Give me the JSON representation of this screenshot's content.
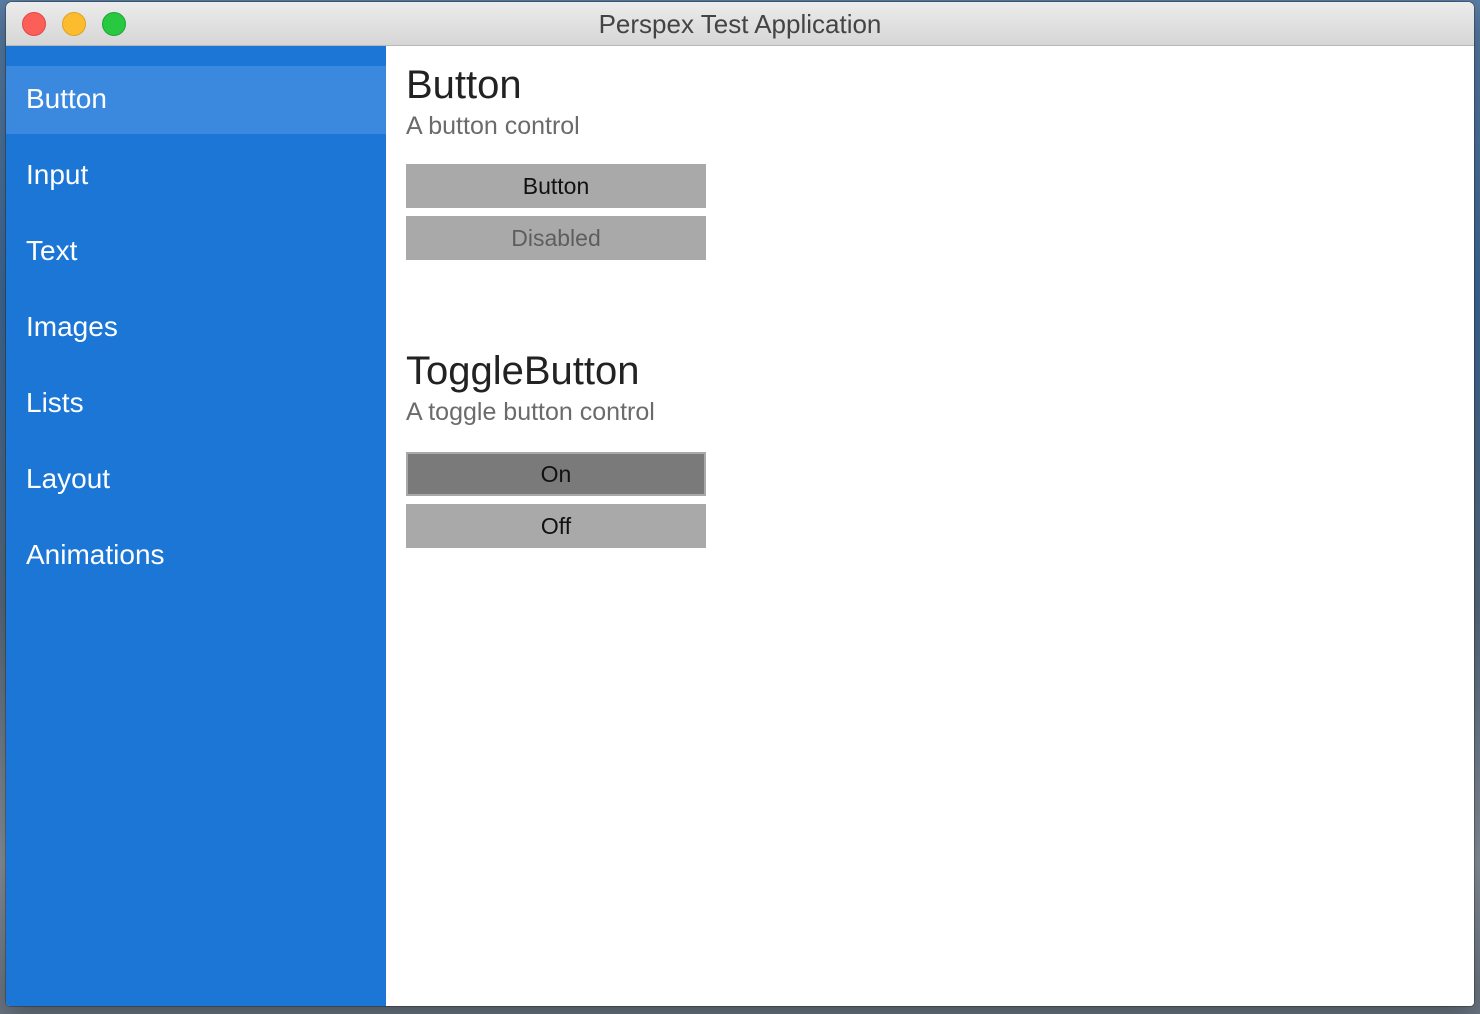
{
  "window": {
    "title": "Perspex Test Application"
  },
  "sidebar": {
    "items": [
      {
        "label": "Button",
        "active": true
      },
      {
        "label": "Input",
        "active": false
      },
      {
        "label": "Text",
        "active": false
      },
      {
        "label": "Images",
        "active": false
      },
      {
        "label": "Lists",
        "active": false
      },
      {
        "label": "Layout",
        "active": false
      },
      {
        "label": "Animations",
        "active": false
      }
    ]
  },
  "main": {
    "button_section": {
      "title": "Button",
      "description": "A button control",
      "button_label": "Button",
      "disabled_label": "Disabled"
    },
    "toggle_section": {
      "title": "ToggleButton",
      "description": "A toggle button control",
      "on_label": "On",
      "off_label": "Off"
    }
  },
  "colors": {
    "sidebar_bg": "#1b76d5",
    "sidebar_active": "#3a89df",
    "button_bg": "#a9a9a9",
    "toggle_on_bg": "#7a7a7a"
  }
}
